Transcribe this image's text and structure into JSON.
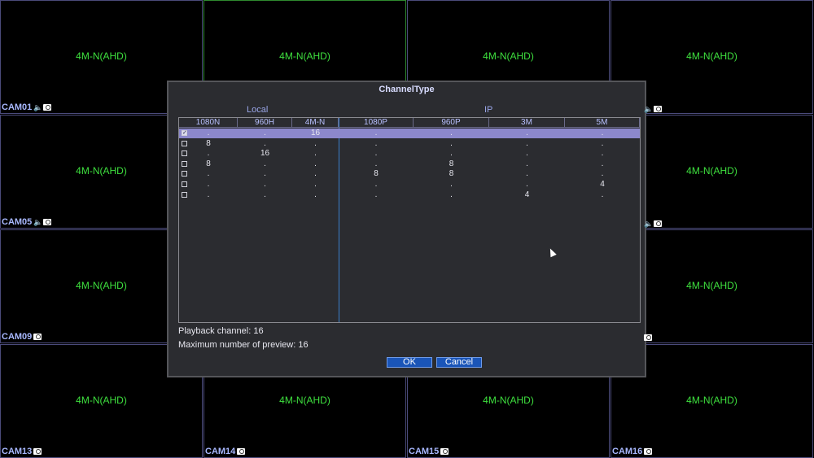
{
  "cameras": [
    {
      "label": "CAM01",
      "res": "4M-N(AHD)"
    },
    {
      "label": "",
      "res": "4M-N(AHD)"
    },
    {
      "label": "",
      "res": "4M-N(AHD)"
    },
    {
      "label": "",
      "res": "4M-N(AHD)"
    },
    {
      "label": "CAM05",
      "res": "4M-N(AHD)"
    },
    {
      "label": "",
      "res": ""
    },
    {
      "label": "",
      "res": ""
    },
    {
      "label": "",
      "res": "4M-N(AHD)"
    },
    {
      "label": "CAM09",
      "res": "4M-N(AHD)"
    },
    {
      "label": "",
      "res": ""
    },
    {
      "label": "",
      "res": ""
    },
    {
      "label": "",
      "res": "4M-N(AHD)"
    },
    {
      "label": "CAM13",
      "res": "4M-N(AHD)"
    },
    {
      "label": "CAM14",
      "res": "4M-N(AHD)"
    },
    {
      "label": "CAM15",
      "res": "4M-N(AHD)"
    },
    {
      "label": "CAM16",
      "res": "4M-N(AHD)"
    }
  ],
  "dialog": {
    "title": "ChannelType",
    "group_local": "Local",
    "group_ip": "IP",
    "columns": [
      "1080N",
      "960H",
      "4M-N",
      "1080P",
      "960P",
      "3M",
      "5M"
    ],
    "rows": [
      {
        "checked": true,
        "values": [
          ".",
          ".",
          "16",
          ".",
          ".",
          ".",
          "."
        ]
      },
      {
        "checked": false,
        "values": [
          "8",
          ".",
          ".",
          ".",
          ".",
          ".",
          "."
        ]
      },
      {
        "checked": false,
        "values": [
          ".",
          "16",
          ".",
          ".",
          ".",
          ".",
          "."
        ]
      },
      {
        "checked": false,
        "values": [
          "8",
          ".",
          ".",
          ".",
          "8",
          ".",
          "."
        ]
      },
      {
        "checked": false,
        "values": [
          ".",
          ".",
          ".",
          "8",
          "8",
          ".",
          "."
        ]
      },
      {
        "checked": false,
        "values": [
          ".",
          ".",
          ".",
          ".",
          ".",
          ".",
          "4"
        ]
      },
      {
        "checked": false,
        "values": [
          ".",
          ".",
          ".",
          ".",
          ".",
          "4",
          "."
        ]
      }
    ],
    "playback": "Playback channel: 16",
    "max_preview": "Maximum number of preview: 16",
    "ok_label": "OK",
    "cancel_label": "Cancel"
  },
  "colors": {
    "resolution_text": "#3ee03e",
    "camera_label": "#a8b8ff",
    "selected_row": "#8c88cc",
    "button": "#1a55b8"
  }
}
